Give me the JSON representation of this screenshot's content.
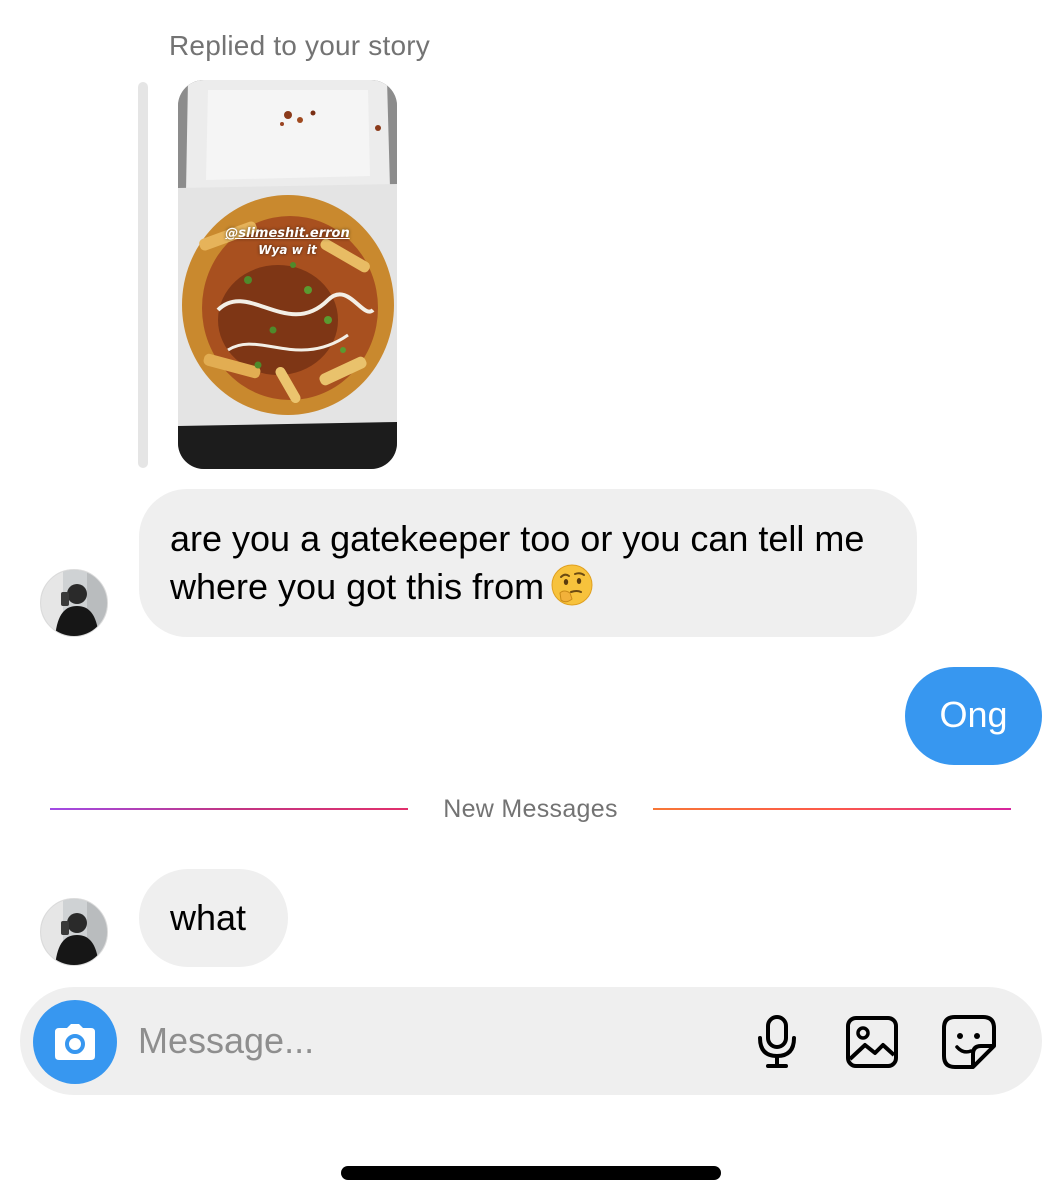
{
  "thread": {
    "reply_caption": "Replied to your story",
    "story": {
      "mention": "@slimeshit.erron",
      "caption": "Wya w it"
    },
    "messages": [
      {
        "from": "them",
        "text": "are you a gatekeeper too or you can tell me where you got this from",
        "emoji": "thinking-face"
      },
      {
        "from": "me",
        "text": "Ong"
      },
      {
        "from": "them",
        "text": "what"
      }
    ],
    "divider_label": "New Messages"
  },
  "composer": {
    "placeholder": "Message...",
    "icons": [
      "camera-icon",
      "microphone-icon",
      "gallery-icon",
      "sticker-icon"
    ]
  },
  "colors": {
    "outgoing_bubble": "#3797f0",
    "incoming_bubble": "#efefef",
    "accent_blue": "#3797f0",
    "secondary_text": "#737373"
  }
}
